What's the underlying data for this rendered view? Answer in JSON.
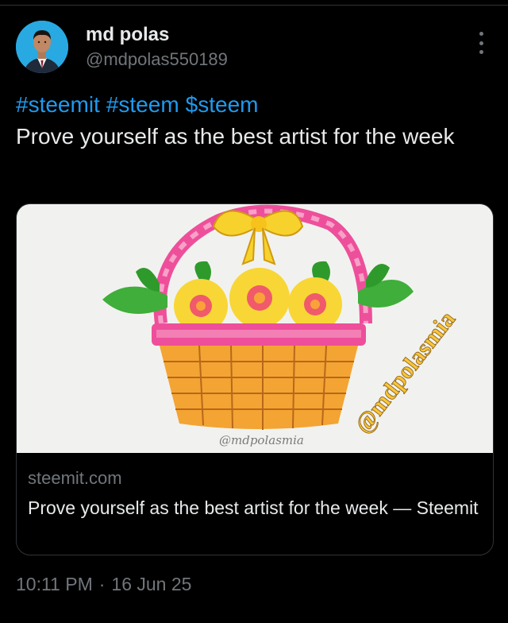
{
  "author": {
    "name": "md polas",
    "handle": "@mdpolas550189"
  },
  "tweet": {
    "hashtags": [
      "#steemit",
      "#steem",
      "$steem"
    ],
    "text": "Prove yourself as the best artist for the week"
  },
  "card": {
    "domain": "steemit.com",
    "title": "Prove yourself as the best artist for the week — Steemit",
    "watermark": "@mdpolasmia",
    "signature": "@mdpolasmia"
  },
  "meta": {
    "time": "10:11 PM",
    "separator": "·",
    "date": "16 Jun 25"
  },
  "colors": {
    "background": "#000000",
    "text": "#e7e9ea",
    "muted": "#71767b",
    "link": "#1d9bf0",
    "border": "#2f3336"
  },
  "icons": {
    "more": "more-vertical-icon"
  }
}
